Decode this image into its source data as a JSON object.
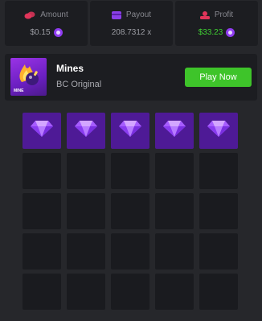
{
  "stats": {
    "amount": {
      "label": "Amount",
      "value": "$0.15",
      "icon": "coins-icon",
      "color": "#e0355a"
    },
    "payout": {
      "label": "Payout",
      "value": "208.7312 x",
      "icon": "wallet-icon",
      "color": "#8b3fe8"
    },
    "profit": {
      "label": "Profit",
      "value": "$33.23",
      "icon": "profit-icon",
      "color": "#e0355a",
      "value_color": "#3fcf32"
    }
  },
  "game": {
    "title": "Mines",
    "subtitle": "BC Original",
    "play_label": "Play Now",
    "thumb_label": "MINE",
    "accent": "#3ec42a"
  },
  "board": {
    "rows": 5,
    "cols": 5,
    "revealed": [
      [
        "gem",
        "gem",
        "gem",
        "gem",
        "gem"
      ],
      [
        "hidden",
        "hidden",
        "hidden",
        "hidden",
        "hidden"
      ],
      [
        "hidden",
        "hidden",
        "hidden",
        "hidden",
        "hidden"
      ],
      [
        "hidden",
        "hidden",
        "hidden",
        "hidden",
        "hidden"
      ],
      [
        "hidden",
        "hidden",
        "hidden",
        "hidden",
        "hidden"
      ]
    ],
    "gem_color": "#a65cff"
  }
}
